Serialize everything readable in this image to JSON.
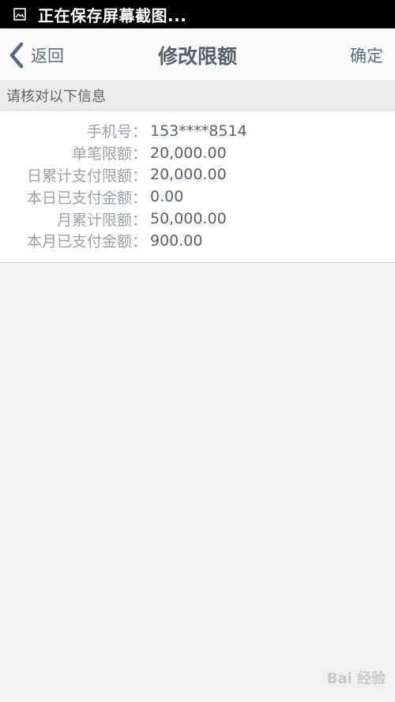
{
  "status_bar": {
    "text": "正在保存屏幕截图..."
  },
  "nav": {
    "back_label": "返回",
    "title": "修改限额",
    "confirm_label": "确定"
  },
  "section": {
    "header": "请核对以下信息"
  },
  "info": {
    "rows": [
      {
        "label": "手机号：",
        "value": "153****8514"
      },
      {
        "label": "单笔限额：",
        "value": "20,000.00"
      },
      {
        "label": "日累计支付限额：",
        "value": "20,000.00"
      },
      {
        "label": "本日已支付金额：",
        "value": "0.00"
      },
      {
        "label": "月累计限额：",
        "value": "50,000.00"
      },
      {
        "label": "本月已支付金额：",
        "value": "900.00"
      }
    ]
  },
  "watermark": {
    "text": "Bai 经验"
  },
  "colors": {
    "accent": "#5b6b7b",
    "title": "#55606c",
    "label": "#98a0a8",
    "background": "#f0f0f0"
  }
}
